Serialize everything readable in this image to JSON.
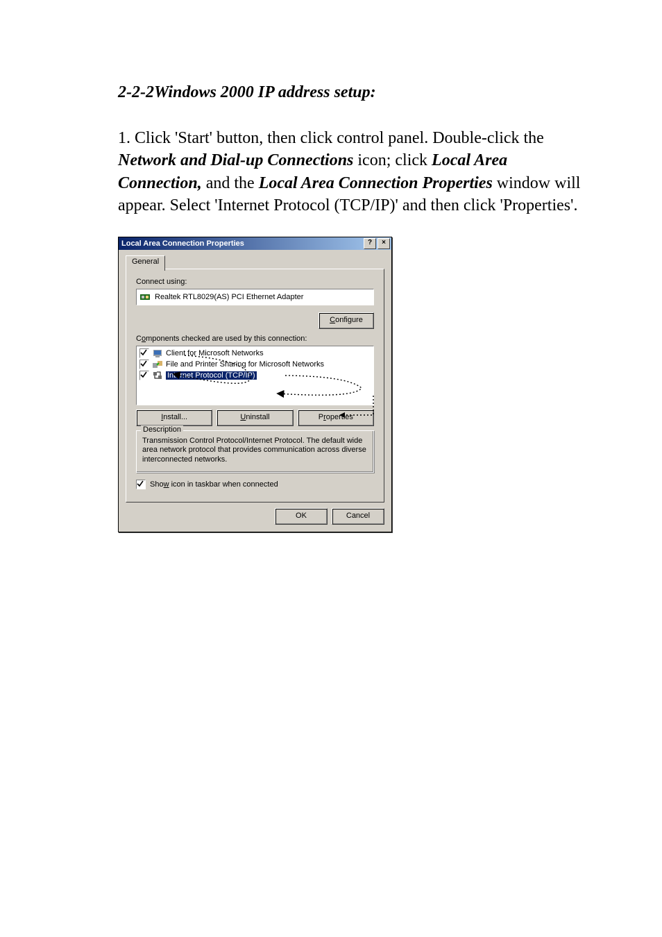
{
  "page": {
    "heading": "2-2-2Windows 2000 IP address setup:",
    "para_html": "1. Click 'Start' button, then click control panel. Double-click the <span class=\"bi\">Network and Dial-up Connections</span> icon; click <span class=\"bi\">Local Area Connection,</span> and the <span class=\"bi\">Local Area Connection Properties</span> window will appear. Select 'Internet Protocol (TCP/IP)' and then click 'Properties'."
  },
  "dialog": {
    "title": "Local Area Connection Properties",
    "help_btn": "?",
    "close_btn": "×",
    "tab_general": "General",
    "connect_using": "Connect using:",
    "adapter": "Realtek RTL8029(AS) PCI Ethernet Adapter",
    "configure": "Configure",
    "components_label": "Components checked are used by this connection:",
    "items": [
      {
        "text": "Client for Microsoft Networks",
        "checked": true,
        "selected": false,
        "icon": "client"
      },
      {
        "text": "File and Printer Sharing for Microsoft Networks",
        "checked": true,
        "selected": false,
        "icon": "share"
      },
      {
        "text": "Internet Protocol (TCP/IP)",
        "checked": true,
        "selected": true,
        "icon": "proto"
      }
    ],
    "install": "Install...",
    "uninstall": "Uninstall",
    "properties": "Properties",
    "description_legend": "Description",
    "description_text": "Transmission Control Protocol/Internet Protocol. The default wide area network protocol that provides communication across diverse interconnected networks.",
    "show_icon": "Show icon in taskbar when connected",
    "ok": "OK",
    "cancel": "Cancel"
  }
}
